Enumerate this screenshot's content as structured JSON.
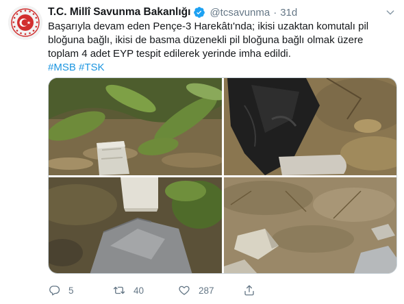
{
  "tweet": {
    "display_name": "T.C. Millî Savunma Bakanlığı",
    "handle": "@tcsavunma",
    "separator": "·",
    "time": "31d",
    "text_lines": [
      "Başarıyla devam eden Pençe-3 Harekâtı'nda; ikisi uzaktan komutalı pil",
      "bloğuna bağlı, ikisi de basma düzenekli pil bloğuna bağlı olmak üzere",
      "toplam 4 adet EYP tespit edilerek yerinde imha edildi."
    ],
    "hashtags": [
      "#MSB",
      "#TSK"
    ],
    "photo_count": 4
  },
  "actions": {
    "reply_count": "5",
    "retweet_count": "40",
    "like_count": "287"
  },
  "icons": {
    "verified": "verified-badge-icon",
    "caret": "chevron-down-icon",
    "reply": "reply-icon",
    "retweet": "retweet-icon",
    "like": "heart-icon",
    "share": "share-icon"
  },
  "colors": {
    "link": "#1b95e0",
    "verified": "#1da1f2",
    "muted": "#657786",
    "text": "#14171a",
    "logo_red": "#d12f2f"
  }
}
